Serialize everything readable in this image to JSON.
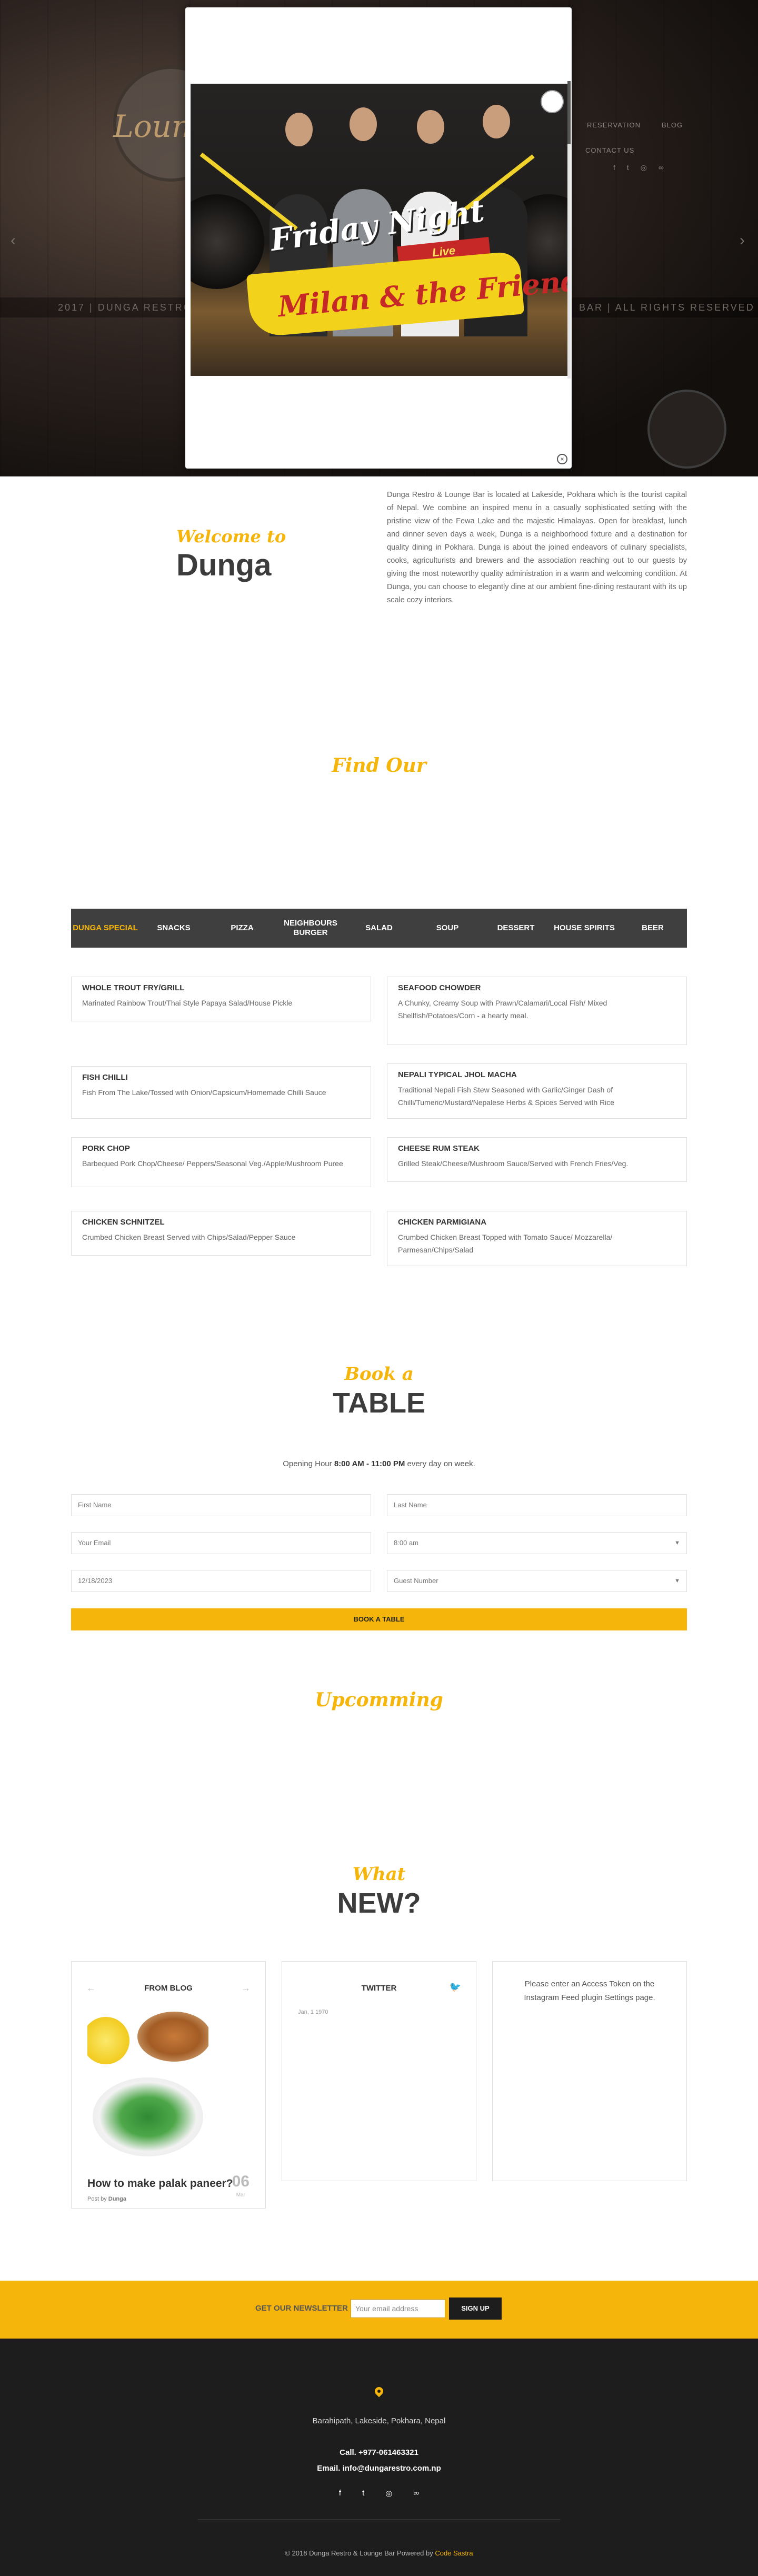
{
  "colors": {
    "accent": "#f5b50a",
    "dark": "#3f3f3f",
    "footer": "#1d1d1d"
  },
  "hero": {
    "logo_text": "Lounge",
    "nav": [
      "RESERVATION",
      "BLOG"
    ],
    "contact": "CONTACT US",
    "band_left": "2017 | DUNGA RESTRO",
    "band_right": "BAR | ALL RIGHTS RESERVED",
    "social_icons": [
      "facebook-icon",
      "twitter-icon",
      "instagram-icon",
      "tripadvisor-icon"
    ]
  },
  "popup": {
    "headline": "Friday Night",
    "tag": "Live Performance",
    "band": "Milan & the Friends",
    "close": "×"
  },
  "welcome": {
    "script": "Welcome to",
    "title": "Dunga",
    "text": "Dunga Restro & Lounge Bar is located at Lakeside, Pokhara which is the tourist capital of Nepal. We combine an inspired menu in a casually sophisticated setting with the pristine view of the Fewa Lake and the majestic Himalayas. Open for breakfast, lunch and dinner seven days a week, Dunga is a neighborhood fixture and a destination for quality dining in Pokhara. Dunga is about the joined endeavors of culinary specialists, cooks, agriculturists and brewers and the association reaching out to our guests by giving the most noteworthy quality administration in a warm and welcoming condition. At Dunga, you can choose to elegantly dine at our ambient fine-dining restaurant with its up scale cozy interiors."
  },
  "menu": {
    "heading": "Find Our",
    "tabs": [
      "DUNGA SPECIAL",
      "SNACKS",
      "PIZZA",
      "NEIGHBOURS BURGER",
      "SALAD",
      "SOUP",
      "DESSERT",
      "HOUSE SPIRITS",
      "BEER"
    ],
    "items": [
      {
        "title": "WHOLE TROUT FRY/GRILL",
        "desc": "Marinated Rainbow Trout/Thai Style Papaya Salad/House Pickle"
      },
      {
        "title": "SEAFOOD CHOWDER",
        "desc": "A Chunky, Creamy Soup with Prawn/Calamari/Local Fish/ Mixed Shellfish/Potatoes/Corn - a hearty meal."
      },
      {
        "title": "FISH CHILLI",
        "desc": "Fish From The Lake/Tossed with Onion/Capsicum/Homemade Chilli Sauce"
      },
      {
        "title": "NEPALI TYPICAL JHOL MACHA",
        "desc": "Traditional Nepali Fish Stew Seasoned with Garlic/Ginger Dash of Chilli/Tumeric/Mustard/Nepalese Herbs & Spices Served with Rice"
      },
      {
        "title": "PORK CHOP",
        "desc": "Barbequed Pork Chop/Cheese/ Peppers/Seasonal Veg./Apple/Mushroom Puree"
      },
      {
        "title": "CHEESE RUM STEAK",
        "desc": "Grilled Steak/Cheese/Mushroom Sauce/Served with French Fries/Veg."
      },
      {
        "title": "CHICKEN SCHNITZEL",
        "desc": "Crumbed Chicken Breast Served with Chips/Salad/Pepper Sauce"
      },
      {
        "title": "CHICKEN PARMIGIANA",
        "desc": "Crumbed Chicken Breast Topped with Tomato Sauce/ Mozzarella/ Parmesan/Chips/Salad"
      }
    ]
  },
  "book": {
    "script": "Book a",
    "title": "TABLE",
    "hours_prefix": "Opening Hour",
    "hours_bold": "8:00 AM - 11:00 PM",
    "hours_suffix": "every day on week.",
    "first_name": "First Name",
    "last_name": "Last Name",
    "email": "Your Email",
    "time": "8:00 am",
    "date": "12/18/2023",
    "guests": "Guest Number",
    "button": "BOOK A TABLE"
  },
  "upcoming": "Upcomming",
  "whatnew": {
    "script": "What",
    "title": "NEW?",
    "blog_title": "FROM BLOG",
    "blog_post": "How to make palak paneer?",
    "blog_by_prefix": "Post by",
    "blog_by": "Dunga",
    "blog_day": "06",
    "blog_month": "Mar",
    "twitter_title": "TWITTER",
    "twitter_date": "Jan, 1 1970",
    "insta_msg": "Please enter an Access Token on the Instagram Feed plugin Settings page."
  },
  "newsletter": {
    "label": "GET OUR NEWSLETTER",
    "placeholder": "Your email address",
    "button": "SIGN UP"
  },
  "footer": {
    "address": "Barahipath, Lakeside, Pokhara, Nepal",
    "call": "Call. +977-061463321",
    "email": "Email. info@dungarestro.com.np",
    "copy_prefix": "© 2018 Dunga Restro & Lounge Bar Powered by",
    "copy_link": "Code Sastra"
  }
}
